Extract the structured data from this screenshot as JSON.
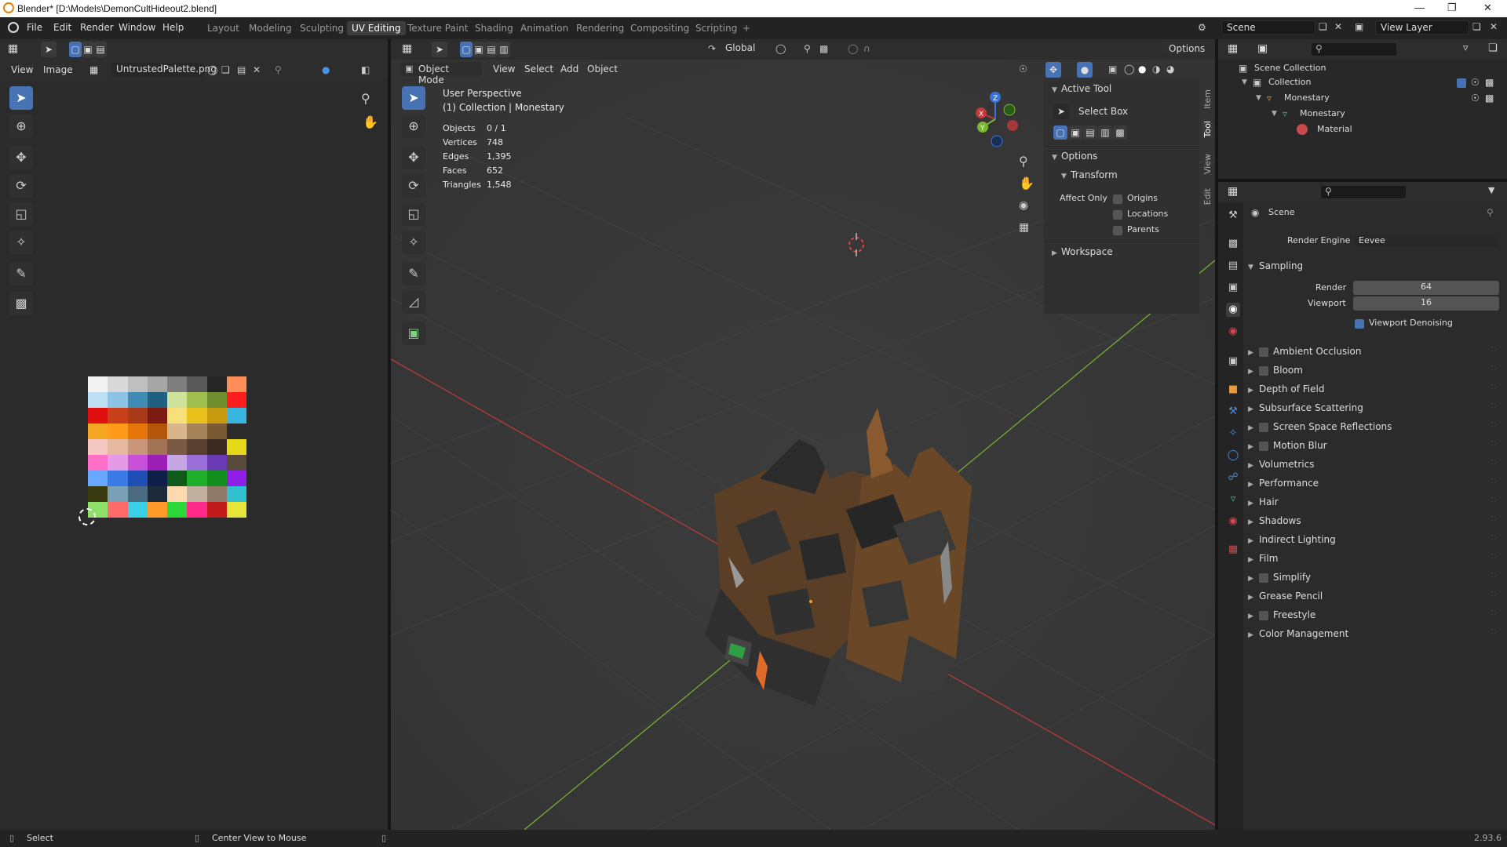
{
  "window": {
    "title": "Blender* [D:\\Models\\DemonCultHideout2.blend]"
  },
  "menu": [
    "File",
    "Edit",
    "Render",
    "Window",
    "Help"
  ],
  "workspaces": [
    "Layout",
    "Modeling",
    "Sculpting",
    "UV Editing",
    "Texture Paint",
    "Shading",
    "Animation",
    "Rendering",
    "Compositing",
    "Scripting"
  ],
  "active_workspace": "UV Editing",
  "scene_field": "Scene",
  "view_layer_field": "View Layer",
  "image_editor": {
    "view": "View",
    "image": "Image",
    "image_name": "UntrustedPalette.png"
  },
  "viewport": {
    "mode": "Object Mode",
    "menus": [
      "View",
      "Select",
      "Add",
      "Object"
    ],
    "orientation": "Global",
    "options": "Options",
    "perspective": "User Perspective",
    "collection": "(1) Collection | Monestary",
    "stats": [
      {
        "label": "Objects",
        "value": "0 / 1"
      },
      {
        "label": "Vertices",
        "value": "748"
      },
      {
        "label": "Edges",
        "value": "1,395"
      },
      {
        "label": "Faces",
        "value": "652"
      },
      {
        "label": "Triangles",
        "value": "1,548"
      }
    ]
  },
  "sidebar": {
    "active_tool": "Active Tool",
    "select_box": "Select Box",
    "options": "Options",
    "transform": "Transform",
    "affect_only": "Affect Only",
    "origins": "Origins",
    "locations": "Locations",
    "parents": "Parents",
    "workspace": "Workspace",
    "tabs": [
      "Item",
      "Tool",
      "View",
      "Edit"
    ]
  },
  "outliner": {
    "scene_collection": "Scene Collection",
    "collection": "Collection",
    "object": "Monestary",
    "mesh": "Monestary",
    "material": "Material"
  },
  "properties": {
    "context": "Scene",
    "render_engine_label": "Render Engine",
    "render_engine": "Eevee",
    "sampling": "Sampling",
    "render_label": "Render",
    "render_samples": "64",
    "viewport_label": "Viewport",
    "viewport_samples": "16",
    "denoising": "Viewport Denoising",
    "sections": [
      {
        "label": "Ambient Occlusion",
        "checkbox": true
      },
      {
        "label": "Bloom",
        "checkbox": true
      },
      {
        "label": "Depth of Field",
        "checkbox": false
      },
      {
        "label": "Subsurface Scattering",
        "checkbox": false
      },
      {
        "label": "Screen Space Reflections",
        "checkbox": true
      },
      {
        "label": "Motion Blur",
        "checkbox": true
      },
      {
        "label": "Volumetrics",
        "checkbox": false
      },
      {
        "label": "Performance",
        "checkbox": false
      },
      {
        "label": "Hair",
        "checkbox": false
      },
      {
        "label": "Shadows",
        "checkbox": false
      },
      {
        "label": "Indirect Lighting",
        "checkbox": false
      },
      {
        "label": "Film",
        "checkbox": false
      },
      {
        "label": "Simplify",
        "checkbox": true
      },
      {
        "label": "Grease Pencil",
        "checkbox": false
      },
      {
        "label": "Freestyle",
        "checkbox": true
      },
      {
        "label": "Color Management",
        "checkbox": false
      }
    ]
  },
  "statusbar": {
    "left": "Select",
    "middle": "Center View to Mouse",
    "version": "2.93.6"
  },
  "colors": {
    "accent": "#4772b3",
    "x_axis": "#c23b3b",
    "y_axis": "#7ab730",
    "z_axis": "#3a74d6"
  },
  "palette": [
    [
      "#f2f2f2",
      "#d9d9d9",
      "#bfbfbf",
      "#a6a6a6",
      "#7f7f7f",
      "#595959",
      "#262626",
      "#ff8f59"
    ],
    [
      "#bde0f5",
      "#8cc4e6",
      "#3f8bb5",
      "#1f5f80",
      "#cfe29b",
      "#9fbf4f",
      "#6f8f2f",
      "#ff1e1e"
    ],
    [
      "#e01010",
      "#c8401a",
      "#a83a1a",
      "#7a1a10",
      "#f7e07a",
      "#e8c11c",
      "#c79c10",
      "#39b5e0"
    ],
    [
      "#f5a623",
      "#ff9a1a",
      "#e6760a",
      "#b3560a",
      "#d9b58c",
      "#a68259",
      "#7a5a35",
      "#2b2b2b"
    ],
    [
      "#f4c7c0",
      "#e6b8a0",
      "#c9967a",
      "#a37356",
      "#7a5a44",
      "#5a4030",
      "#3a2a20",
      "#e8d81a"
    ],
    [
      "#ff6ec7",
      "#e69ae6",
      "#c84fd8",
      "#9b1fb5",
      "#c7a6e6",
      "#9b6fd8",
      "#6a3ab5",
      "#5a4a3a"
    ],
    [
      "#6aa8ff",
      "#3a7ae6",
      "#1f4fb5",
      "#0f1f4a",
      "#0f5a1a",
      "#1fae2a",
      "#138f1f",
      "#8f1fe6"
    ],
    [
      "#3a3a10",
      "#7aa0b5",
      "#4a6a80",
      "#1a2a3a",
      "#ffd8b0",
      "#c0b0a0",
      "#8f7a6a",
      "#30c0d0"
    ],
    [
      "#8fe06a",
      "#ff6a6a",
      "#3ad0e6",
      "#ff9a2a",
      "#2ad83a",
      "#ff2a8a",
      "#c01a1a",
      "#e6e63a"
    ]
  ]
}
